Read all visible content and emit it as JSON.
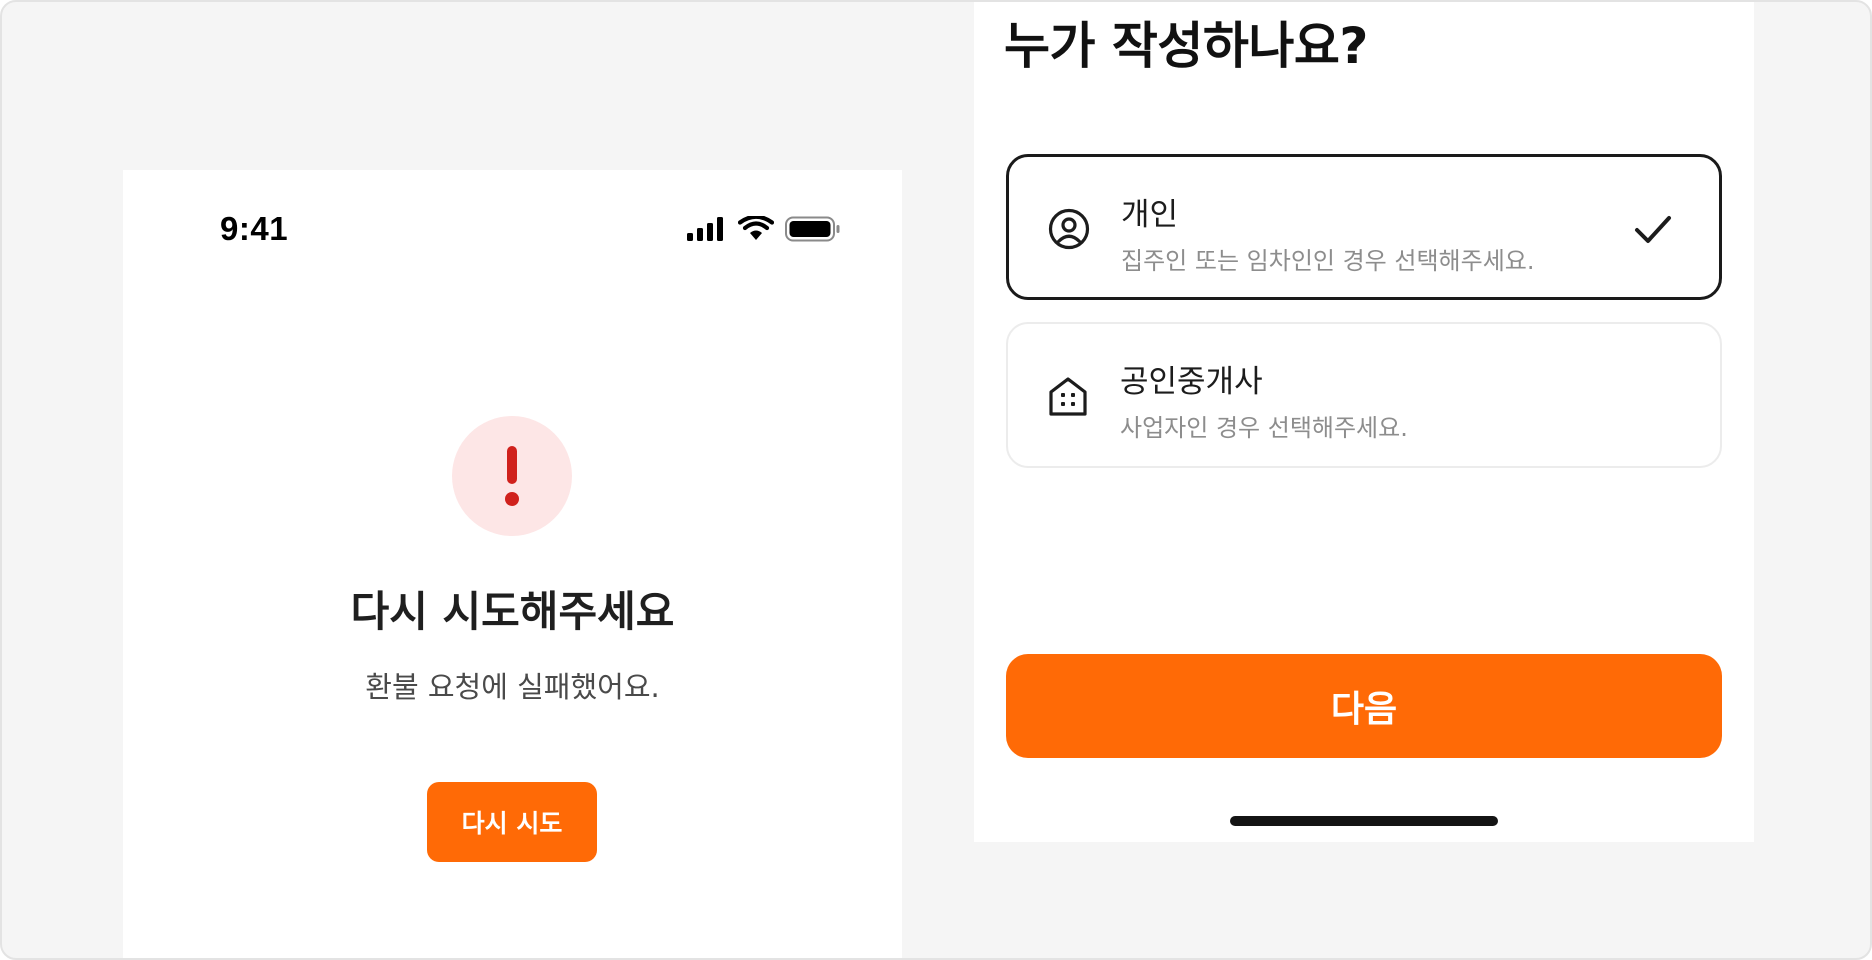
{
  "error_screen": {
    "status_time": "9:41",
    "title": "다시 시도해주세요",
    "description": "환불 요청에 실패했어요.",
    "retry_label": "다시 시도"
  },
  "select_screen": {
    "title": "누가 작성하나요?",
    "options": [
      {
        "title": "개인",
        "description": "집주인 또는 임차인인 경우 선택해주세요.",
        "icon": "user-circle-icon",
        "selected": true
      },
      {
        "title": "공인중개사",
        "description": "사업자인 경우 선택해주세요.",
        "icon": "building-icon",
        "selected": false
      }
    ],
    "next_label": "다음"
  },
  "colors": {
    "accent": "#ff6a06",
    "error": "#d0211c",
    "error_bg": "#fde6e6"
  }
}
